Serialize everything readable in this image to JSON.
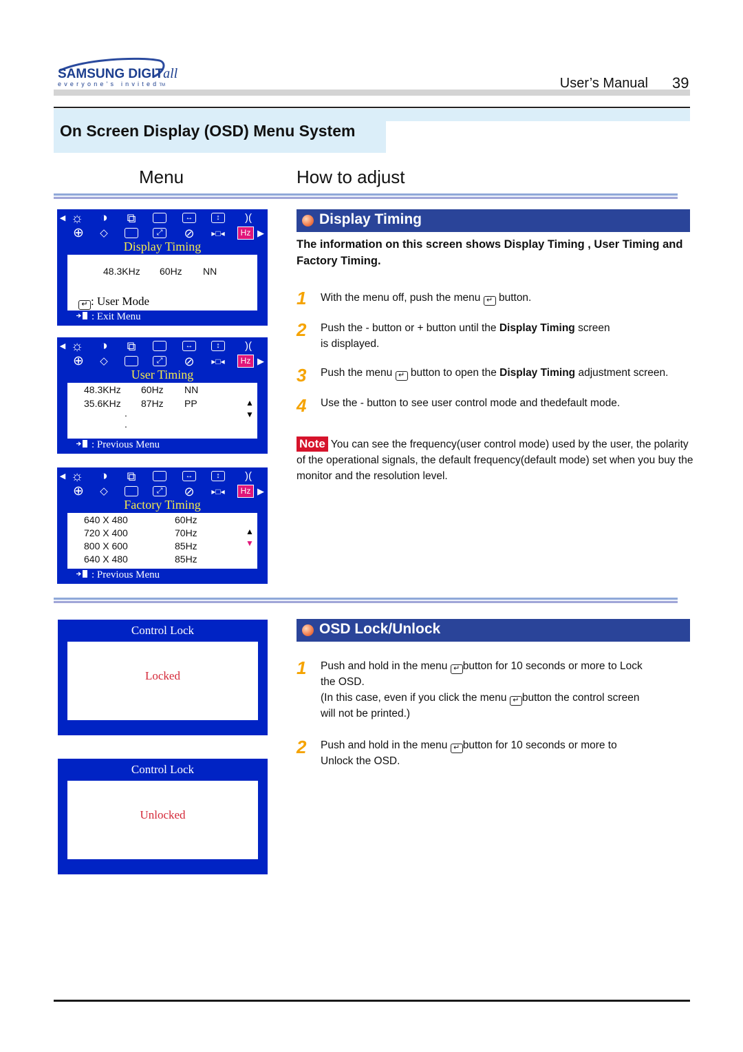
{
  "header": {
    "brand": "SAMSUNG DIGIT",
    "brand_suffix": "all",
    "tagline": "everyone's invited",
    "tagline_tm": "TM",
    "manual_label": "User’s  Manual",
    "page_number": "39"
  },
  "section_title": "On Screen Display (OSD) Menu System",
  "columns": {
    "menu": "Menu",
    "how_to_adjust": "How to adjust"
  },
  "osd_icons": {
    "row1": [
      "left-arrow",
      "brightness-icon",
      "contrast-icon",
      "position-icon",
      "size-icon",
      "h-size-icon",
      "v-size-icon",
      "pincushion-icon"
    ],
    "row2": [
      "rotation-icon",
      "trapezoid-icon",
      "parallelogram-icon",
      "zoom-icon",
      "degauss-icon",
      "moire-icon",
      "hz-icon",
      "right-arrow"
    ],
    "hz_label": "Hz"
  },
  "display_timing_panel": {
    "title": "Display Timing",
    "row": [
      "48.3KHz",
      "60Hz",
      "NN"
    ],
    "user_mode": ": User Mode",
    "exit": ": Exit Menu"
  },
  "user_timing_panel": {
    "title": "User Timing",
    "rows": [
      [
        "48.3KHz",
        "60Hz",
        "NN"
      ],
      [
        "35.6KHz",
        "87Hz",
        "PP"
      ]
    ],
    "dots": [
      ".",
      "."
    ],
    "footer": ": Previous Menu"
  },
  "factory_timing_panel": {
    "title": "Factory Timing",
    "rows": [
      [
        "640 X 480",
        "60Hz"
      ],
      [
        "720 X 400",
        "70Hz"
      ],
      [
        "800 X 600",
        "85Hz"
      ],
      [
        "640 X 480",
        "85Hz"
      ]
    ],
    "footer": ": Previous Menu"
  },
  "display_timing": {
    "heading": "Display Timing",
    "intro": "The information on this screen shows Display Timing , User Timing and Factory Timing.",
    "steps": [
      {
        "num": "1",
        "pre": "With the menu off, push the menu ",
        "post": " button."
      },
      {
        "num": "2",
        "pre": "Push the - button or  + button until the  ",
        "bold": "Display Timing",
        "post": " screen is displayed."
      },
      {
        "num": "3",
        "pre": "Push the menu ",
        "mid": " button to open the ",
        "bold": "Display Timing",
        "post": " adjustment screen."
      },
      {
        "num": "4",
        "pre": "Use the - button to see user control mode and thedefault mode."
      }
    ],
    "note_label": "Note",
    "note_text": "You can see the frequency(user control mode) used by the user, the polarity of the operational signals, the default frequency(default mode) set when you buy the monitor and the resolution level."
  },
  "osd_lock": {
    "heading": "OSD Lock/Unlock",
    "steps": [
      {
        "num": "1",
        "pre": "Push and hold in the menu ",
        "post": "button for 10 seconds or more to Lock  the OSD.",
        "extra_pre": "(In this case, even if you click the menu ",
        "extra_post": "button the control screen will not be printed.)"
      },
      {
        "num": "2",
        "pre": "Push and hold in the menu ",
        "post": "button for 10 seconds or more to Unlock the OSD."
      }
    ],
    "panels": [
      {
        "title": "Control Lock",
        "value": "Locked"
      },
      {
        "title": "Control Lock",
        "value": "Unlocked"
      }
    ]
  },
  "colors": {
    "osd_blue": "#0023c4",
    "osd_title_yellow": "#f4ea4e",
    "hz_pink": "#e0167a",
    "heading_blue": "#2a4499",
    "step_orange": "#f5a300",
    "note_red": "#d6132b",
    "lock_red": "#d42838",
    "section_bg": "#dbeef9"
  }
}
